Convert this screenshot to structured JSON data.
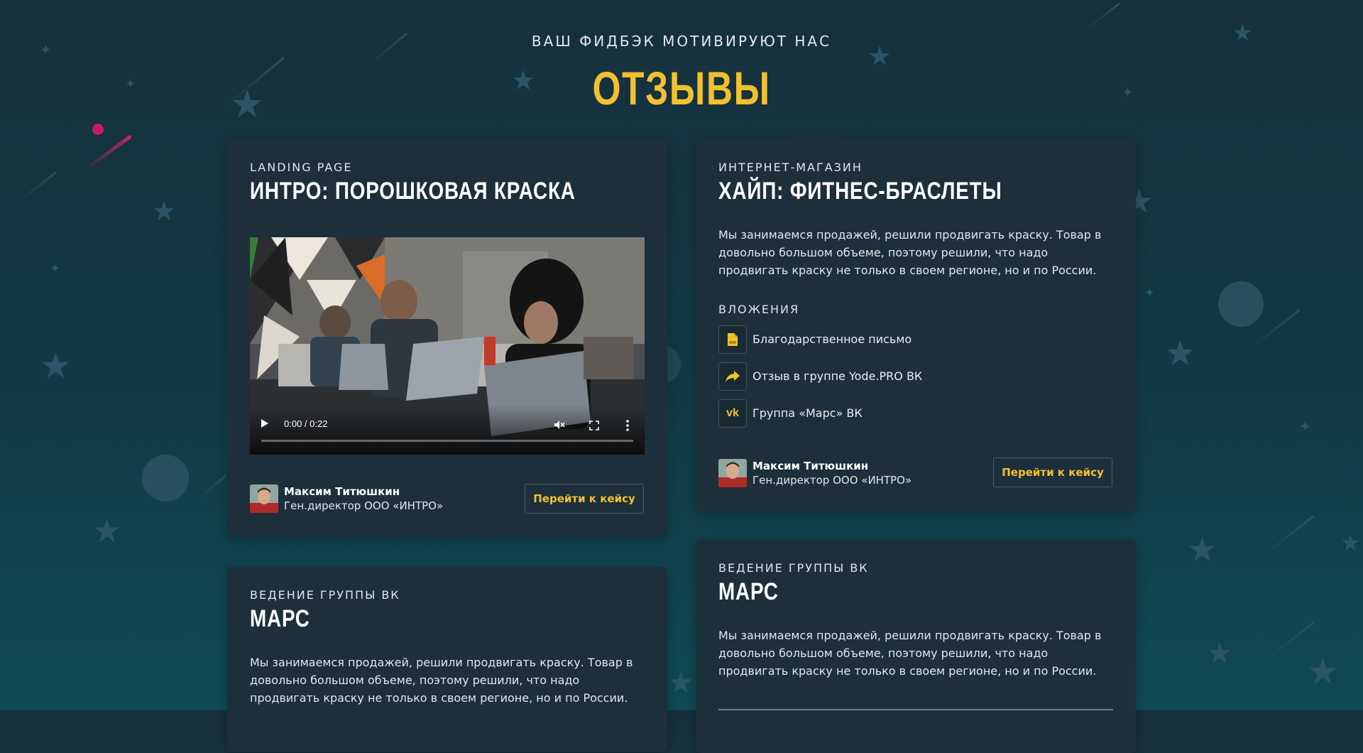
{
  "section": {
    "kicker": "ВАШ ФИДБЭК МОТИВИРУЮТ НАС",
    "title": "ОТЗЫВЫ"
  },
  "reviews": [
    {
      "category": "LANDING PAGE",
      "title": "ИНТРО: ПОРОШКОВАЯ КРАСКА",
      "video": {
        "time": "0:00 / 0:22",
        "progress": 0,
        "play_icon": "play-icon",
        "mute_icon": "mute-icon",
        "fullscreen_icon": "fullscreen-icon",
        "more_icon": "more-options-icon"
      },
      "author": {
        "name": "Максим Титюшкин",
        "role": "Ген.директор ООО «ИНТРО»"
      },
      "button_label": "Перейти к кейсу"
    },
    {
      "category": "ИНТЕРНЕТ-МАГАЗИН",
      "title": "ХАЙП: ФИТНЕС-БРАСЛЕТЫ",
      "description": "Мы занимаемся продажей, решили продвигать краску. Товар в довольно большом объеме, поэтому решили, что надо продвигать краску не только в своем регионе, но и по России.",
      "attachments_label": "ВЛОЖЕНИЯ",
      "attachments": [
        {
          "icon": "pdf-file-icon",
          "label": "Благодарственное письмо"
        },
        {
          "icon": "share-arrow-icon",
          "label": "Отзыв в группе Yode.PRO ВК"
        },
        {
          "icon": "vk-icon",
          "label": "Группа «Марс» ВК"
        }
      ],
      "author": {
        "name": "Максим Титюшкин",
        "role": "Ген.директор ООО «ИНТРО»"
      },
      "button_label": "Перейти к кейсу"
    },
    {
      "category": "ВЕДЕНИЕ ГРУППЫ ВК",
      "title": "МАРС",
      "description": "Мы занимаемся продажей, решили продвигать краску. Товар в довольно большом объеме, поэтому решили, что надо продвигать краску не только в своем регионе, но и по России."
    },
    {
      "category": "ВЕДЕНИЕ ГРУППЫ ВК",
      "title": "МАРС",
      "description": "Мы занимаемся продажей, решили продвигать краску. Товар в довольно большом объеме, поэтому решили, что надо продвигать краску не только в своем регионе, но и по России."
    }
  ],
  "colors": {
    "accent": "#f2c12e",
    "card_background": "#1c2f3a",
    "page_background": "#133642"
  }
}
